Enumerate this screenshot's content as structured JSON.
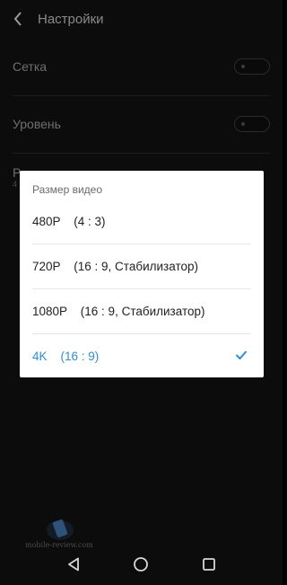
{
  "header": {
    "title": "Настройки",
    "back_icon": "chevron-left-icon"
  },
  "settings": {
    "grid_label": "Сетка",
    "level_label": "Уровень",
    "partial_label": "Р",
    "partial_sub": "4"
  },
  "dialog": {
    "title": "Размер видео",
    "options": [
      {
        "label": "480P    (4 : 3)",
        "selected": false
      },
      {
        "label": "720P    (16 : 9, Стабилизатор)",
        "selected": false
      },
      {
        "label": "1080P    (16 : 9, Стабилизатор)",
        "selected": false
      },
      {
        "label": "4K    (16 : 9)",
        "selected": true
      }
    ],
    "accent_color": "#2a8fe0"
  },
  "watermark": {
    "text": "mobile-review.com"
  },
  "navbar": {
    "back_icon": "triangle-back-icon",
    "home_icon": "circle-home-icon",
    "recents_icon": "square-recents-icon"
  }
}
